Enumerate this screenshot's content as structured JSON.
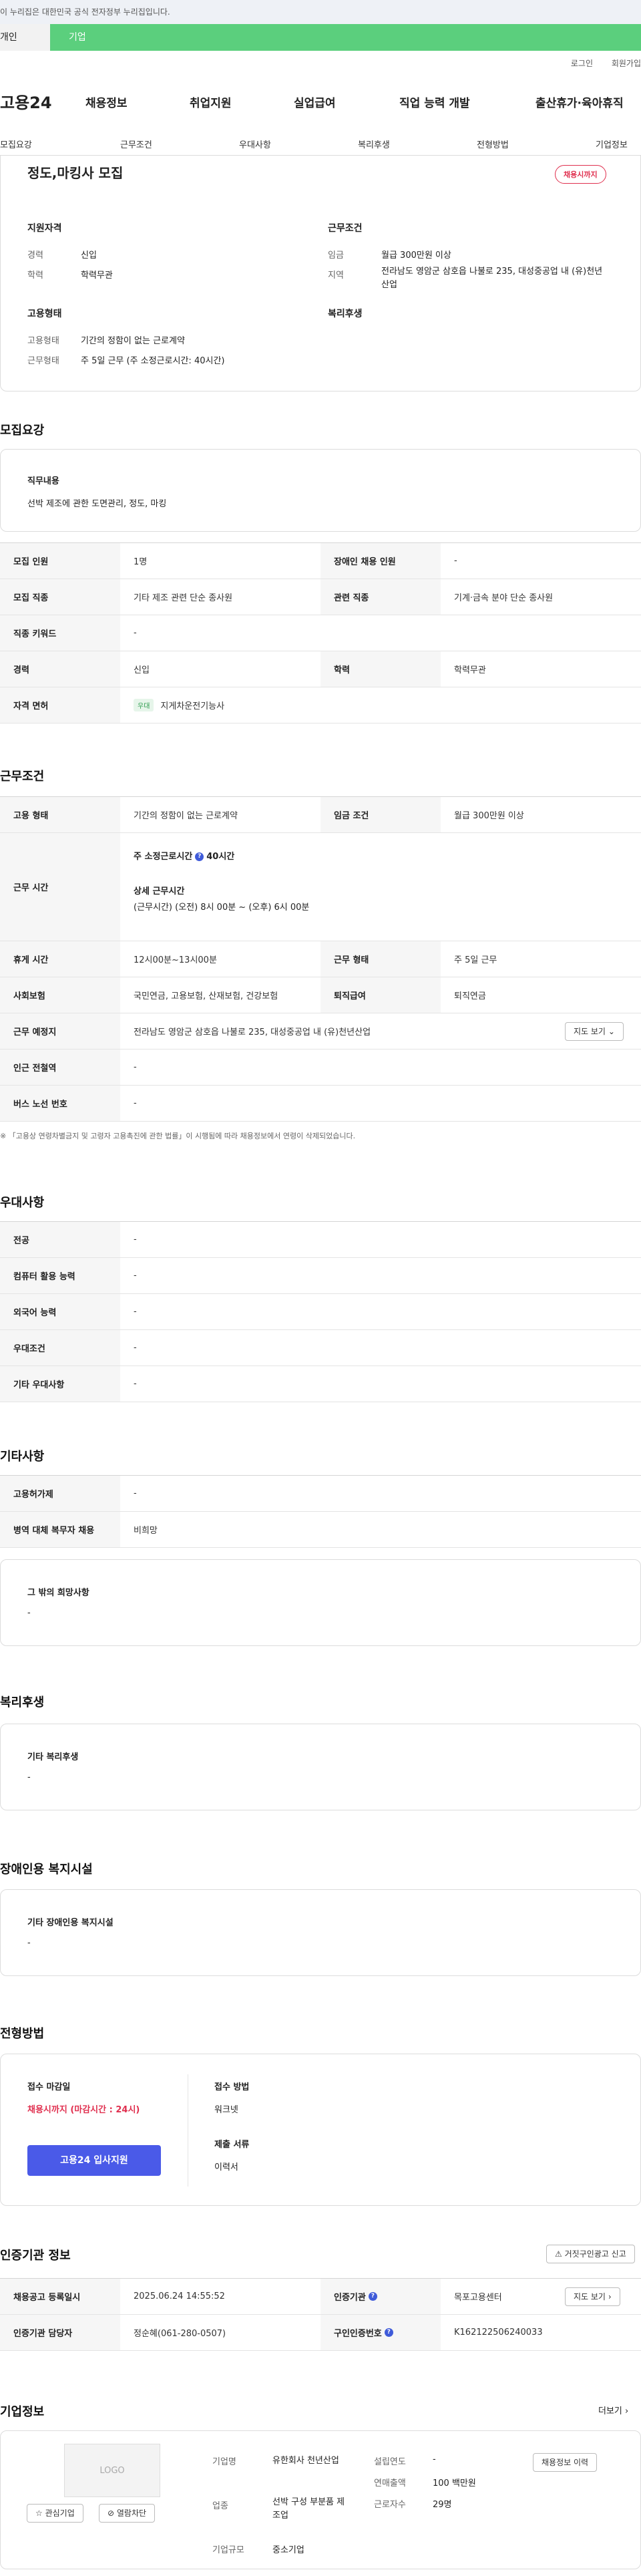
{
  "gov_banner": "이 누리집은 대한민국 공식 전자정부 누리집입니다.",
  "tabs": {
    "personal": "개인",
    "company": "기업"
  },
  "util": {
    "login": "로그인",
    "signup": "회원가입"
  },
  "header": {
    "logo": "고용24",
    "gnb": [
      "채용정보",
      "취업지원",
      "실업급여",
      "직업 능력 개발",
      "출산휴가·육아휴직"
    ]
  },
  "subnav": [
    "모집요강",
    "근무조건",
    "우대사항",
    "복리후생",
    "전형방법",
    "기업정보"
  ],
  "summary": {
    "title": "정도,마킹사 모집",
    "badge": "채용시까지",
    "qual": {
      "heading": "지원자격",
      "career_label": "경력",
      "career": "신입",
      "edu_label": "학력",
      "edu": "학력무관"
    },
    "work": {
      "heading": "근무조건",
      "wage_label": "임금",
      "wage": "월급 300만원 이상",
      "region_label": "지역",
      "region": "전라남도 영암군 삼호읍 나불로 235, 대성중공업 내 (유)천년산업"
    },
    "employ": {
      "heading": "고용형태",
      "type_label": "고용형태",
      "type": "기간의 정함이 없는 근로계약",
      "form_label": "근무형태",
      "form": "주 5일 근무 (주 소정근로시간: 40시간)"
    },
    "welfare_heading": "복리후생"
  },
  "recruit": {
    "title": "모집요강",
    "job_desc_heading": "직무내용",
    "job_desc": "선박 제조에 관한 도면관리, 정도, 마킹",
    "rows": [
      {
        "h1": "모집 인원",
        "v1": "1명",
        "h2": "장애인 채용 인원",
        "v2": "-"
      },
      {
        "h1": "모집 직종",
        "v1": "기타 제조 관련 단순 종사원",
        "h2": "관련 직종",
        "v2": "기계·금속 분야 단순 종사원"
      },
      {
        "h1": "직종 키워드",
        "v1": "-"
      },
      {
        "h1": "경력",
        "v1": "신입",
        "h2": "학력",
        "v2": "학력무관"
      },
      {
        "h1": "자격 면허",
        "chip": "우대",
        "v1": "지게차운전기능사"
      }
    ]
  },
  "conditions": {
    "title": "근무조건",
    "r1": {
      "h1": "고용 형태",
      "v1": "기간의 정함이 없는 근로계약",
      "h2": "임금 조건",
      "v2": "월급 300만원 이상"
    },
    "hours": {
      "h": "근무 시간",
      "weekly_label": "주 소정근로시간",
      "weekly_value": "40시간",
      "detail_label": "상세 근무시간",
      "detail": "(근무시간) (오전) 8시 00분 ~ (오후) 6시 00분"
    },
    "r3": {
      "h1": "휴게 시간",
      "v1": "12시00분~13시00분",
      "h2": "근무 형태",
      "v2": "주 5일 근무"
    },
    "r4": {
      "h1": "사회보험",
      "v1": "국민연금, 고용보험, 산재보험, 건강보험",
      "h2": "퇴직급여",
      "v2": "퇴직연금"
    },
    "r5": {
      "h1": "근무 예정지",
      "v1": "전라남도 영암군 삼호읍 나불로 235, 대성중공업 내 (유)천년산업",
      "btn": "지도 보기"
    },
    "r6": {
      "h1": "인근 전철역",
      "v1": "-"
    },
    "r7": {
      "h1": "버스 노선 번호",
      "v1": "-"
    },
    "note": "※ 「고용상 연령차별금지 및 고령자 고용촉진에 관한 법률」이 시행됨에 따라 채용정보에서 연령이 삭제되었습니다."
  },
  "preference": {
    "title": "우대사항",
    "rows": [
      {
        "h": "전공",
        "v": "-"
      },
      {
        "h": "컴퓨터 활용 능력",
        "v": "-"
      },
      {
        "h": "외국어 능력",
        "v": "-"
      },
      {
        "h": "우대조건",
        "v": "-"
      },
      {
        "h": "기타 우대사항",
        "v": "-"
      }
    ]
  },
  "etc": {
    "title": "기타사항",
    "rows": [
      {
        "h": "고용허가제",
        "v": "-"
      },
      {
        "h": "병역 대체 복무자 채용",
        "v": "비희망"
      }
    ],
    "hope_heading": "그 밖의 희망사항",
    "hope": "-"
  },
  "welfare": {
    "title": "복리후생",
    "heading": "기타 복리후생",
    "value": "-"
  },
  "disability": {
    "title": "장애인용 복지시설",
    "heading": "기타 장애인용 복지시설",
    "value": "-"
  },
  "selection": {
    "title": "전형방법",
    "deadline_heading": "접수 마감일",
    "deadline": "채용시까지 (마감시간 : 24시)",
    "apply_btn": "고용24 입사지원",
    "method_heading": "접수 방법",
    "method": "워크넷",
    "docs_heading": "제출 서류",
    "docs": "이력서"
  },
  "certify": {
    "title": "인증기관 정보",
    "report_btn": "거짓구인광고 신고",
    "r1": {
      "h1": "채용공고 등록일시",
      "v1": "2025.06.24 14:55:52",
      "h2": "인증기관",
      "v2": "목포고용센터",
      "btn": "지도 보기"
    },
    "r2": {
      "h1": "인증기관 담당자",
      "v1": "정순혜(061-280-0507)",
      "h2": "구인인증번호",
      "v2": "K162122506240033"
    }
  },
  "company": {
    "title": "기업정보",
    "more": "더보기",
    "logo_text": "LOGO",
    "fav_btn": "관심기업",
    "block_btn": "열람차단",
    "name_label": "기업명",
    "name": "유한회사 천년산업",
    "industry_label": "업종",
    "industry": "선박 구성 부분품 제조업",
    "scale_label": "기업규모",
    "scale": "중소기업",
    "founded_label": "설립연도",
    "founded": "-",
    "sales_label": "연매출액",
    "sales": "100 백만원",
    "staff_label": "근로자수",
    "staff": "29명",
    "history_btn": "채용정보 이력"
  }
}
